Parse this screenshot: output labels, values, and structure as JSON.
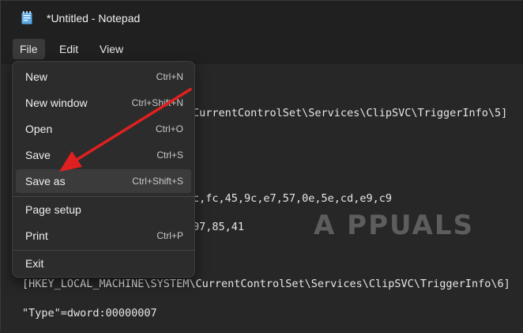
{
  "window": {
    "title": "*Untitled - Notepad",
    "icon": "notepad-icon"
  },
  "menubar": {
    "items": [
      {
        "label": "File"
      },
      {
        "label": "Edit"
      },
      {
        "label": "View"
      }
    ]
  },
  "file_menu": {
    "items": [
      {
        "label": "New",
        "shortcut": "Ctrl+N"
      },
      {
        "label": "New window",
        "shortcut": "Ctrl+Shift+N"
      },
      {
        "label": "Open",
        "shortcut": "Ctrl+O"
      },
      {
        "label": "Save",
        "shortcut": "Ctrl+S"
      },
      {
        "label": "Save as",
        "shortcut": "Ctrl+Shift+S"
      },
      {
        "label": "Page setup",
        "shortcut": ""
      },
      {
        "label": "Print",
        "shortcut": "Ctrl+P"
      },
      {
        "label": "Exit",
        "shortcut": ""
      }
    ],
    "highlighted": "Save as"
  },
  "editor": {
    "lines": [
      "CurrentControlSet\\Services\\ClipSVC\\TriggerInfo\\5]",
      "c,fc,45,9c,e7,57,0e,5e,cd,e9,c9",
      "07,85,41",
      "[HKEY_LOCAL_MACHINE\\SYSTEM\\CurrentControlSet\\Services\\ClipSVC\\TriggerInfo\\6]",
      "\"Type\"=dword:00000007"
    ]
  },
  "watermark": "A PPUALS",
  "colors": {
    "background": "#272727",
    "titlebar": "#202020",
    "menu": "#2c2c2c",
    "arrow": "#e02020"
  }
}
